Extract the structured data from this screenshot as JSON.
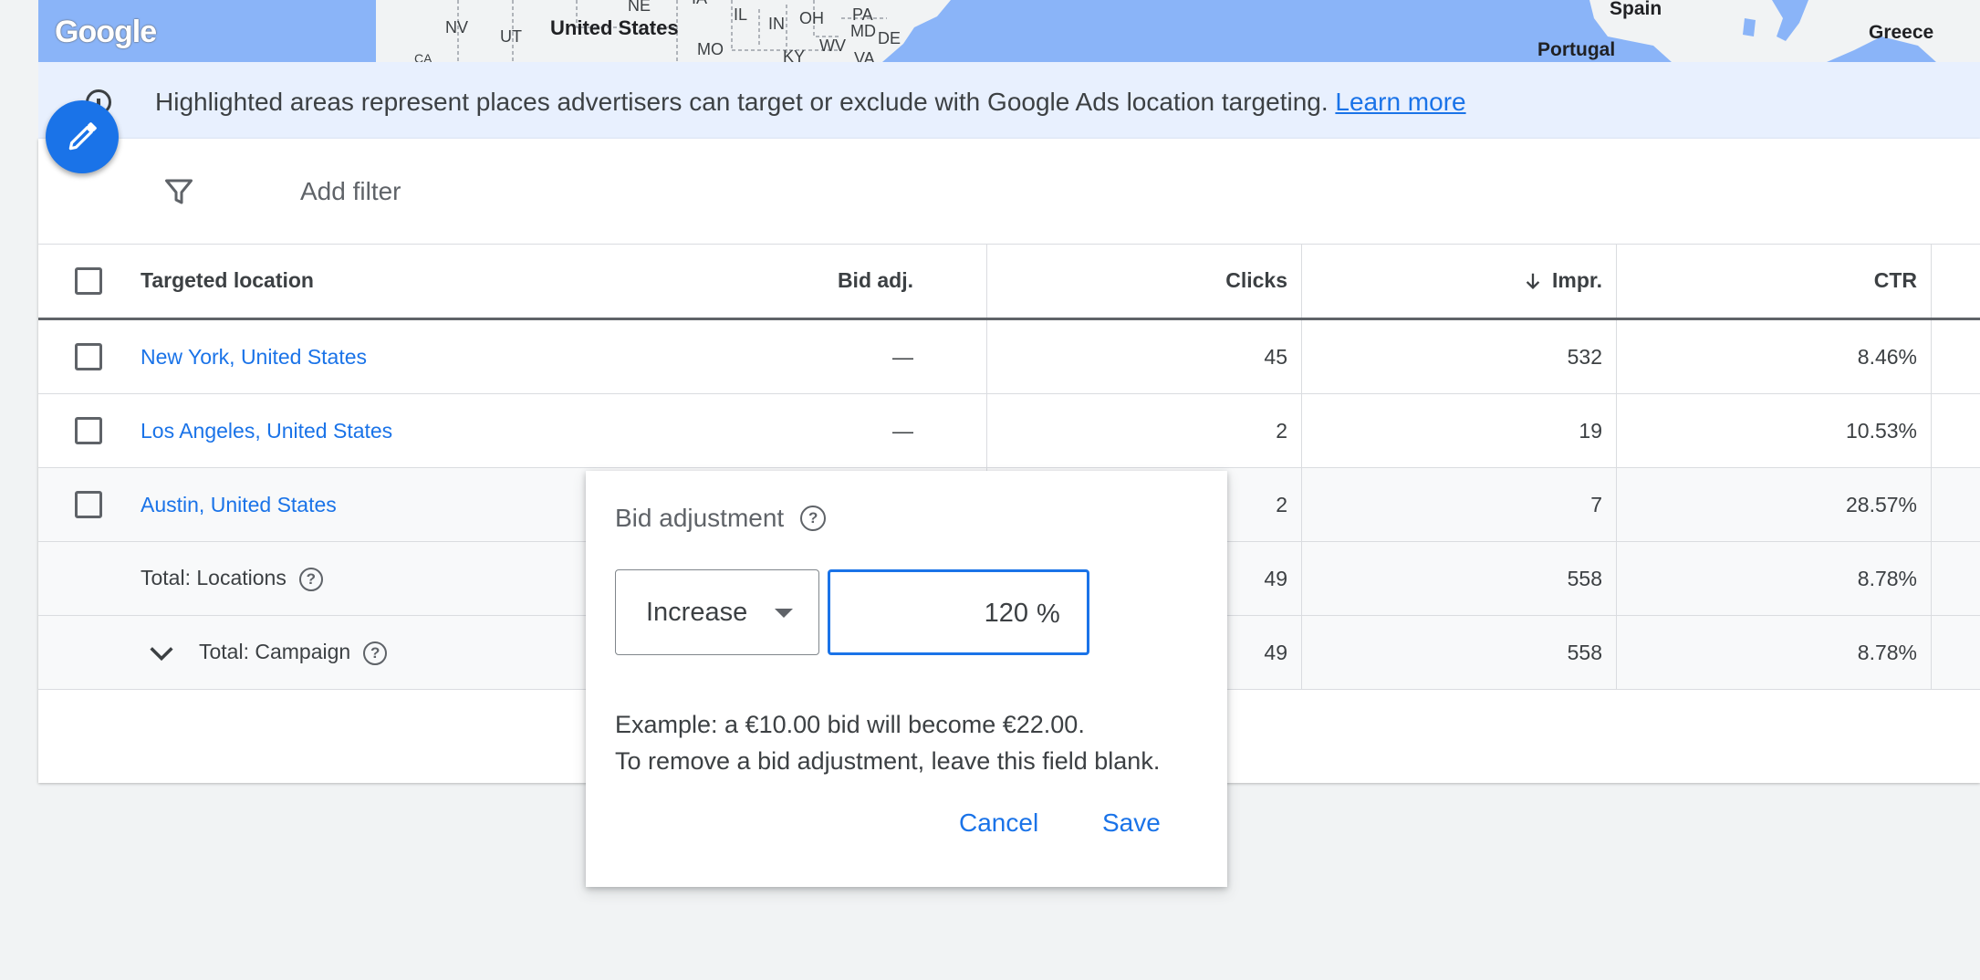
{
  "map": {
    "logo": "Google",
    "labels": {
      "nv": "NV",
      "ut": "UT",
      "ca": "CA",
      "us": "United States",
      "ne": "NE",
      "ia": "IA",
      "il": "IL",
      "in": "IN",
      "oh": "OH",
      "pa": "PA",
      "md": "MD",
      "de": "DE",
      "mo": "MO",
      "ky": "KY",
      "wv": "WV",
      "va": "VA",
      "spain": "Spain",
      "portugal": "Portugal",
      "greece": "Greece"
    }
  },
  "banner": {
    "text": "Highlighted areas represent places advertisers can target or exclude with Google Ads location targeting.",
    "link": "Learn more"
  },
  "filter": {
    "add_filter": "Add filter"
  },
  "table": {
    "headers": {
      "location": "Targeted location",
      "bid_adj": "Bid adj.",
      "clicks": "Clicks",
      "impr": "Impr.",
      "ctr": "CTR"
    },
    "rows": [
      {
        "location": "New York, United States",
        "bid_adj": "—",
        "clicks": "45",
        "impr": "532",
        "ctr": "8.46%"
      },
      {
        "location": "Los Angeles, United States",
        "bid_adj": "—",
        "clicks": "2",
        "impr": "19",
        "ctr": "10.53%"
      },
      {
        "location": "Austin, United States",
        "bid_adj": "",
        "clicks": "2",
        "impr": "7",
        "ctr": "28.57%"
      }
    ],
    "totals": {
      "locations": {
        "label": "Total: Locations",
        "clicks": "49",
        "impr": "558",
        "ctr": "8.78%"
      },
      "campaign": {
        "label": "Total: Campaign",
        "clicks": "49",
        "impr": "558",
        "ctr": "8.78%"
      }
    }
  },
  "popup": {
    "title": "Bid adjustment",
    "select_value": "Increase",
    "input_value": "120",
    "suffix": "%",
    "example_line1": "Example: a €10.00 bid will become €22.00.",
    "example_line2": "To remove a bid adjustment, leave this field blank.",
    "cancel": "Cancel",
    "save": "Save"
  },
  "colors": {
    "accent": "#1a73e8",
    "map_water": "#8ab4f8",
    "map_land": "#f1f3f4",
    "banner_bg": "#e8f0fe"
  }
}
